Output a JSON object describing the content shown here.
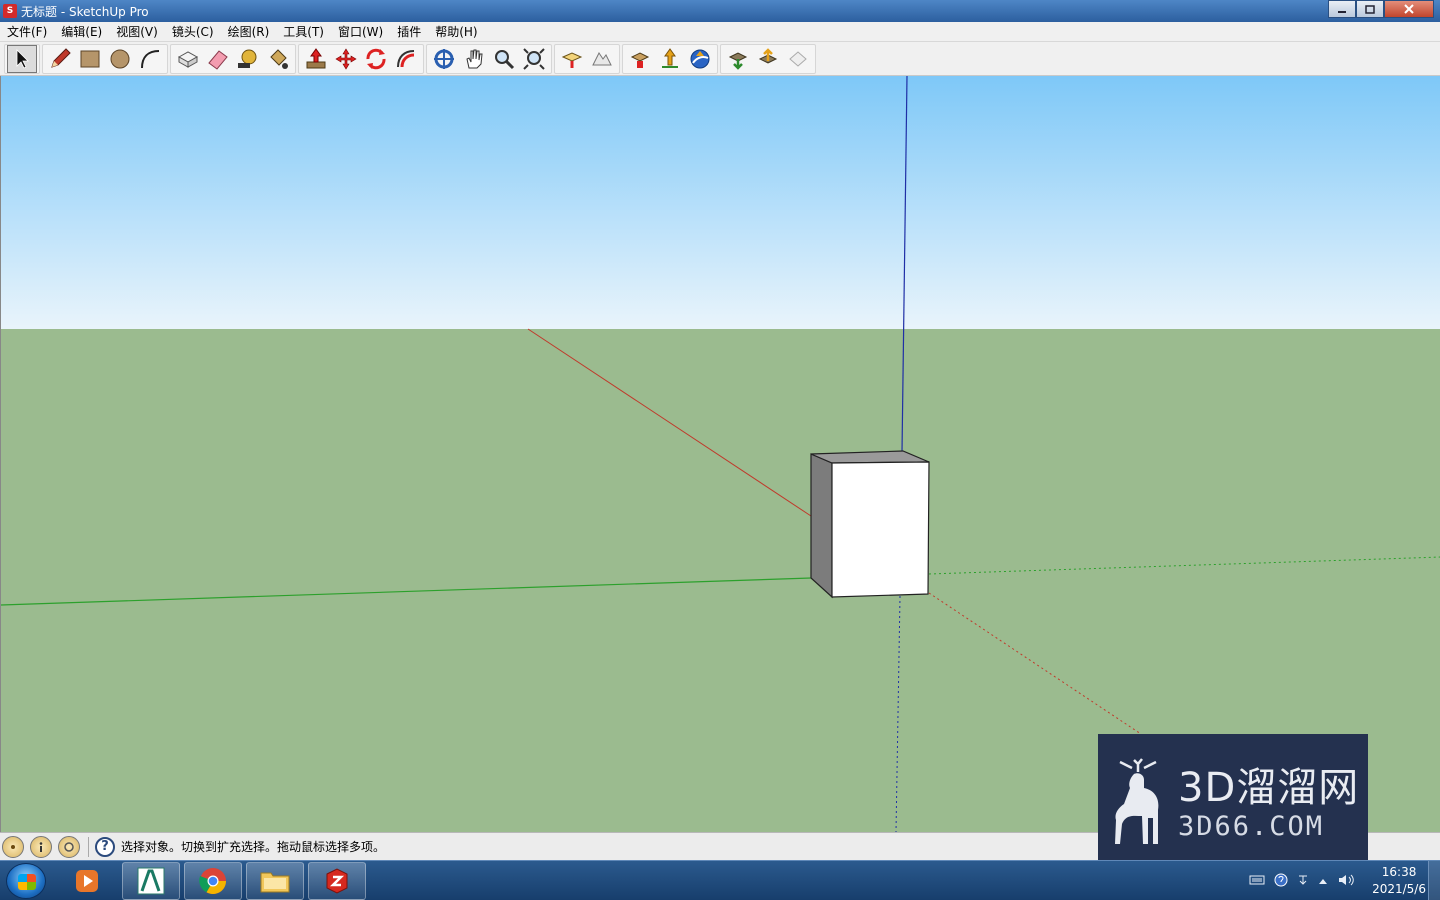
{
  "window": {
    "title": "无标题 - SketchUp Pro",
    "app_icon": "sketchup-icon",
    "controls": [
      "minimize",
      "maximize",
      "close"
    ]
  },
  "menu": {
    "items": [
      "文件(F)",
      "编辑(E)",
      "视图(V)",
      "镜头(C)",
      "绘图(R)",
      "工具(T)",
      "窗口(W)",
      "插件",
      "帮助(H)"
    ]
  },
  "toolbar": {
    "tools": [
      "select",
      "pencil",
      "rectangle",
      "circle",
      "arc",
      "make-component",
      "eraser",
      "tape-measure",
      "paint-bucket",
      "push-pull",
      "move",
      "rotate",
      "follow-me",
      "orbit",
      "pan",
      "zoom",
      "zoom-extents",
      "add-location",
      "toggle-terrain",
      "get-models",
      "share-model",
      "google-earth",
      "get-models-2",
      "share-component",
      "upload"
    ],
    "active_tool": "select"
  },
  "viewport": {
    "sky_top_color": "#7ec8f8",
    "sky_bottom_color": "#e9f4fb",
    "ground_color": "#9bbb8f",
    "axis_red": "#c0392b",
    "axis_green": "#2ca02c",
    "axis_blue": "#1f2fa6",
    "object": "box"
  },
  "status": {
    "icons": [
      "geo-location-icon",
      "credits-icon",
      "user-icon"
    ],
    "help_glyph": "?",
    "text": "选择对象。切换到扩充选择。拖动鼠标选择多项。"
  },
  "watermark": {
    "title": "3D溜溜网",
    "url": "3D66.COM",
    "logo": "deer-logo"
  },
  "taskbar": {
    "apps": [
      "media-player-icon",
      "autocad-icon",
      "chrome-icon",
      "file-explorer-icon",
      "sketchup-icon"
    ],
    "clock_time": "16:38",
    "clock_date": "2021/5/6",
    "tray_icons": [
      "keyboard-icon",
      "help-icon",
      "network-icon",
      "show-hidden-icon",
      "volume-icon"
    ]
  }
}
